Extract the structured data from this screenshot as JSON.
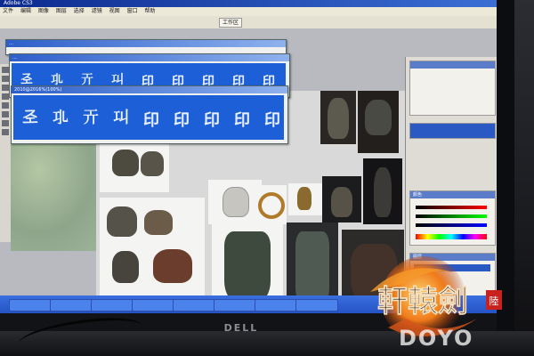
{
  "screen": {
    "app_title": "Adobe CS3",
    "menu_items": [
      "文件",
      "编辑",
      "图像",
      "图层",
      "选择",
      "滤镜",
      "视图",
      "窗口",
      "帮助"
    ],
    "workspace_label": "工作区"
  },
  "documents": [
    {
      "title": "…",
      "glyphs": [
        "𢀖",
        "𢀗",
        "𢀘",
        "𢀙",
        "印",
        "印",
        "印",
        "印",
        "印"
      ]
    },
    {
      "title": "…",
      "glyphs": [
        "𢀖",
        "𢀗",
        "𢀘",
        "𢀙",
        "印",
        "印",
        "印",
        "印",
        "印"
      ]
    },
    {
      "title": "2010@2016%(100%)",
      "glyphs": [
        "𢀖",
        "𢀗",
        "𢀘",
        "𢀙",
        "印",
        "印",
        "印",
        "印",
        "印"
      ]
    }
  ],
  "panels": {
    "color_header": "颜色",
    "layers_header": "图层"
  },
  "monitor": {
    "brand": "DELL"
  },
  "logo": {
    "title": "軒轅劍",
    "subtitle": "DOYO",
    "seal": "陸"
  },
  "colors": {
    "seal_blue": "#1d5fd6",
    "logo_orange": "#f07a1a"
  }
}
